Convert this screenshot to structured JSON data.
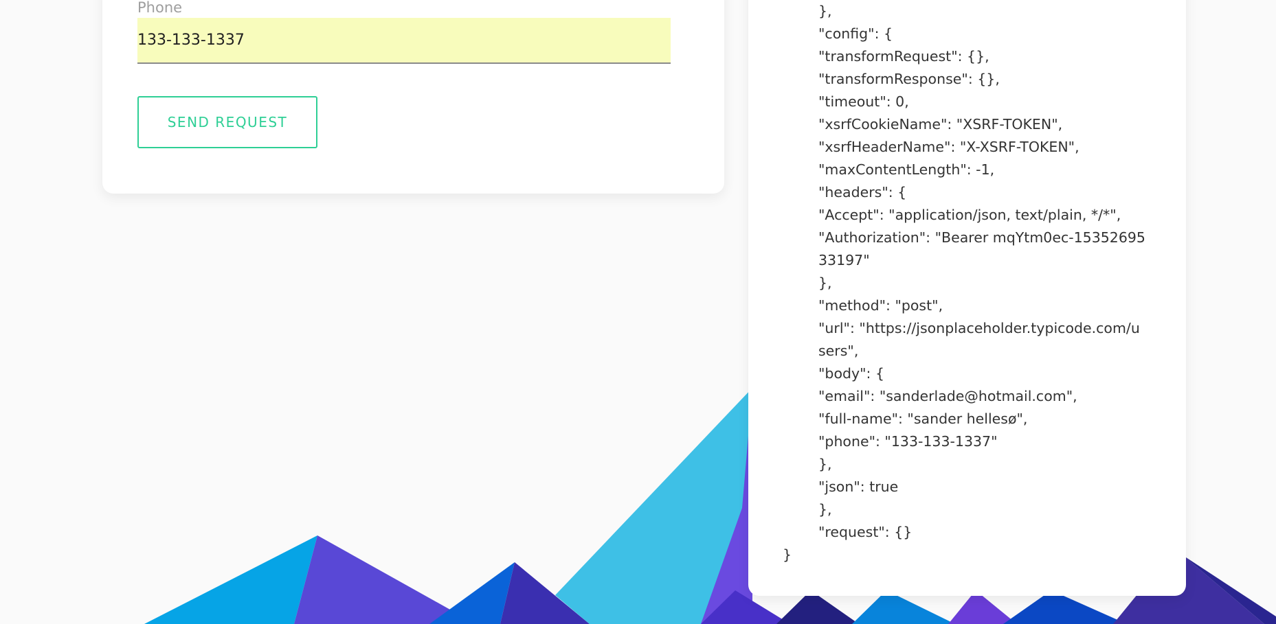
{
  "form": {
    "phone_label": "Phone",
    "phone_value": "133-133-1337",
    "send_button_label": "SEND REQUEST"
  },
  "response": {
    "lines": [
      {
        "text": "},",
        "indent": 1
      },
      {
        "text": "\"config\": {",
        "indent": 1
      },
      {
        "text": "\"transformRequest\": {},",
        "indent": 1
      },
      {
        "text": "\"transformResponse\": {},",
        "indent": 1
      },
      {
        "text": "\"timeout\": 0,",
        "indent": 1
      },
      {
        "text": "\"xsrfCookieName\": \"XSRF-TOKEN\",",
        "indent": 1
      },
      {
        "text": "\"xsrfHeaderName\": \"X-XSRF-TOKEN\",",
        "indent": 1
      },
      {
        "text": "\"maxContentLength\": -1,",
        "indent": 1
      },
      {
        "text": "\"headers\": {",
        "indent": 1
      },
      {
        "text": "\"Accept\": \"application/json, text/plain, */*\",",
        "indent": 1
      },
      {
        "text": "\"Authorization\": \"Bearer mqYtm0ec-15352695",
        "indent": 1
      },
      {
        "text": "33197\"",
        "indent": 1
      },
      {
        "text": "},",
        "indent": 1
      },
      {
        "text": "\"method\": \"post\",",
        "indent": 1
      },
      {
        "text": "\"url\": \"https://jsonplaceholder.typicode.com/u",
        "indent": 1
      },
      {
        "text": "sers\",",
        "indent": 1
      },
      {
        "text": "\"body\": {",
        "indent": 1
      },
      {
        "text": "\"email\": \"sanderlade@hotmail.com\",",
        "indent": 1
      },
      {
        "text": "\"full-name\": \"sander hellesø\",",
        "indent": 1
      },
      {
        "text": "\"phone\": \"133-133-1337\"",
        "indent": 1
      },
      {
        "text": "},",
        "indent": 1
      },
      {
        "text": "\"json\": true",
        "indent": 1
      },
      {
        "text": "},",
        "indent": 1
      },
      {
        "text": "\"request\": {}",
        "indent": 1
      },
      {
        "text": "}",
        "indent": 0
      }
    ]
  },
  "colors": {
    "accent": "#2ecf95",
    "autofill_background": "#f8fcbc",
    "page_background": "#fafafa"
  }
}
